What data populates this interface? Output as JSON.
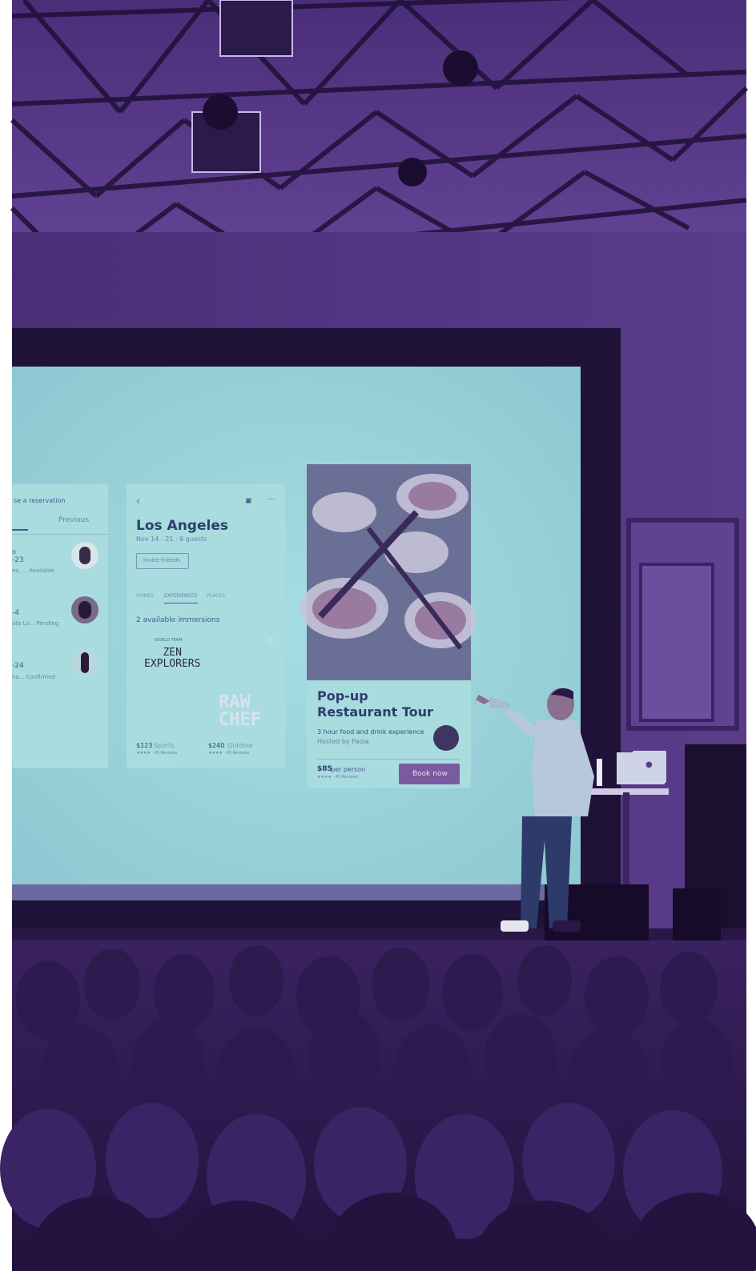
{
  "colors": {
    "tint_dark": "#2a1747",
    "tint_mid": "#5b3a8c",
    "screen": "#9fd6dc",
    "card": "#a8dcdf",
    "slide_text": "#3a4a80",
    "button": "#7a5aa0"
  },
  "left_card": {
    "header": "se a reservation",
    "tab_previous": "Previous",
    "items": [
      {
        "line1": "n",
        "line2": "-23",
        "line3": "es, ... Available"
      },
      {
        "line1": "",
        "line2": "-4",
        "line3": "ato Lo... Pending"
      },
      {
        "line1": "",
        "line2": "-24",
        "line3": "na... Confirmed"
      }
    ]
  },
  "mid_card": {
    "back_icon": "chevron-left-icon",
    "share_icon": "gift-icon",
    "more_icon": "more-icon",
    "title": "Los Angeles",
    "subtitle": "Nov 14 - 21 · 6 guests",
    "invite_button": "Invite friends",
    "tabs": [
      "HOMES",
      "EXPERIENCES",
      "PLACES"
    ],
    "section_title": "2 available immersions",
    "poster_1": {
      "small": "WORLD TEAM",
      "title": "ZEN\nEXPLORERS",
      "price": "$123",
      "category": "Sports",
      "reviews": "★★★★ · 45 Reviews"
    },
    "poster_2": {
      "title": "RAW\nCHEF",
      "price": "$240",
      "category": "Outdoor",
      "reviews": "★★★★ · 45 Reviews"
    }
  },
  "right_card": {
    "title": "Pop-up\nRestaurant Tour",
    "description": "3 hour food and drink experience",
    "host": "Hosted by Paola",
    "price": "$85",
    "price_unit": "per person",
    "reviews": "★★★★ · 45 Reviews",
    "cta": "Book now"
  }
}
